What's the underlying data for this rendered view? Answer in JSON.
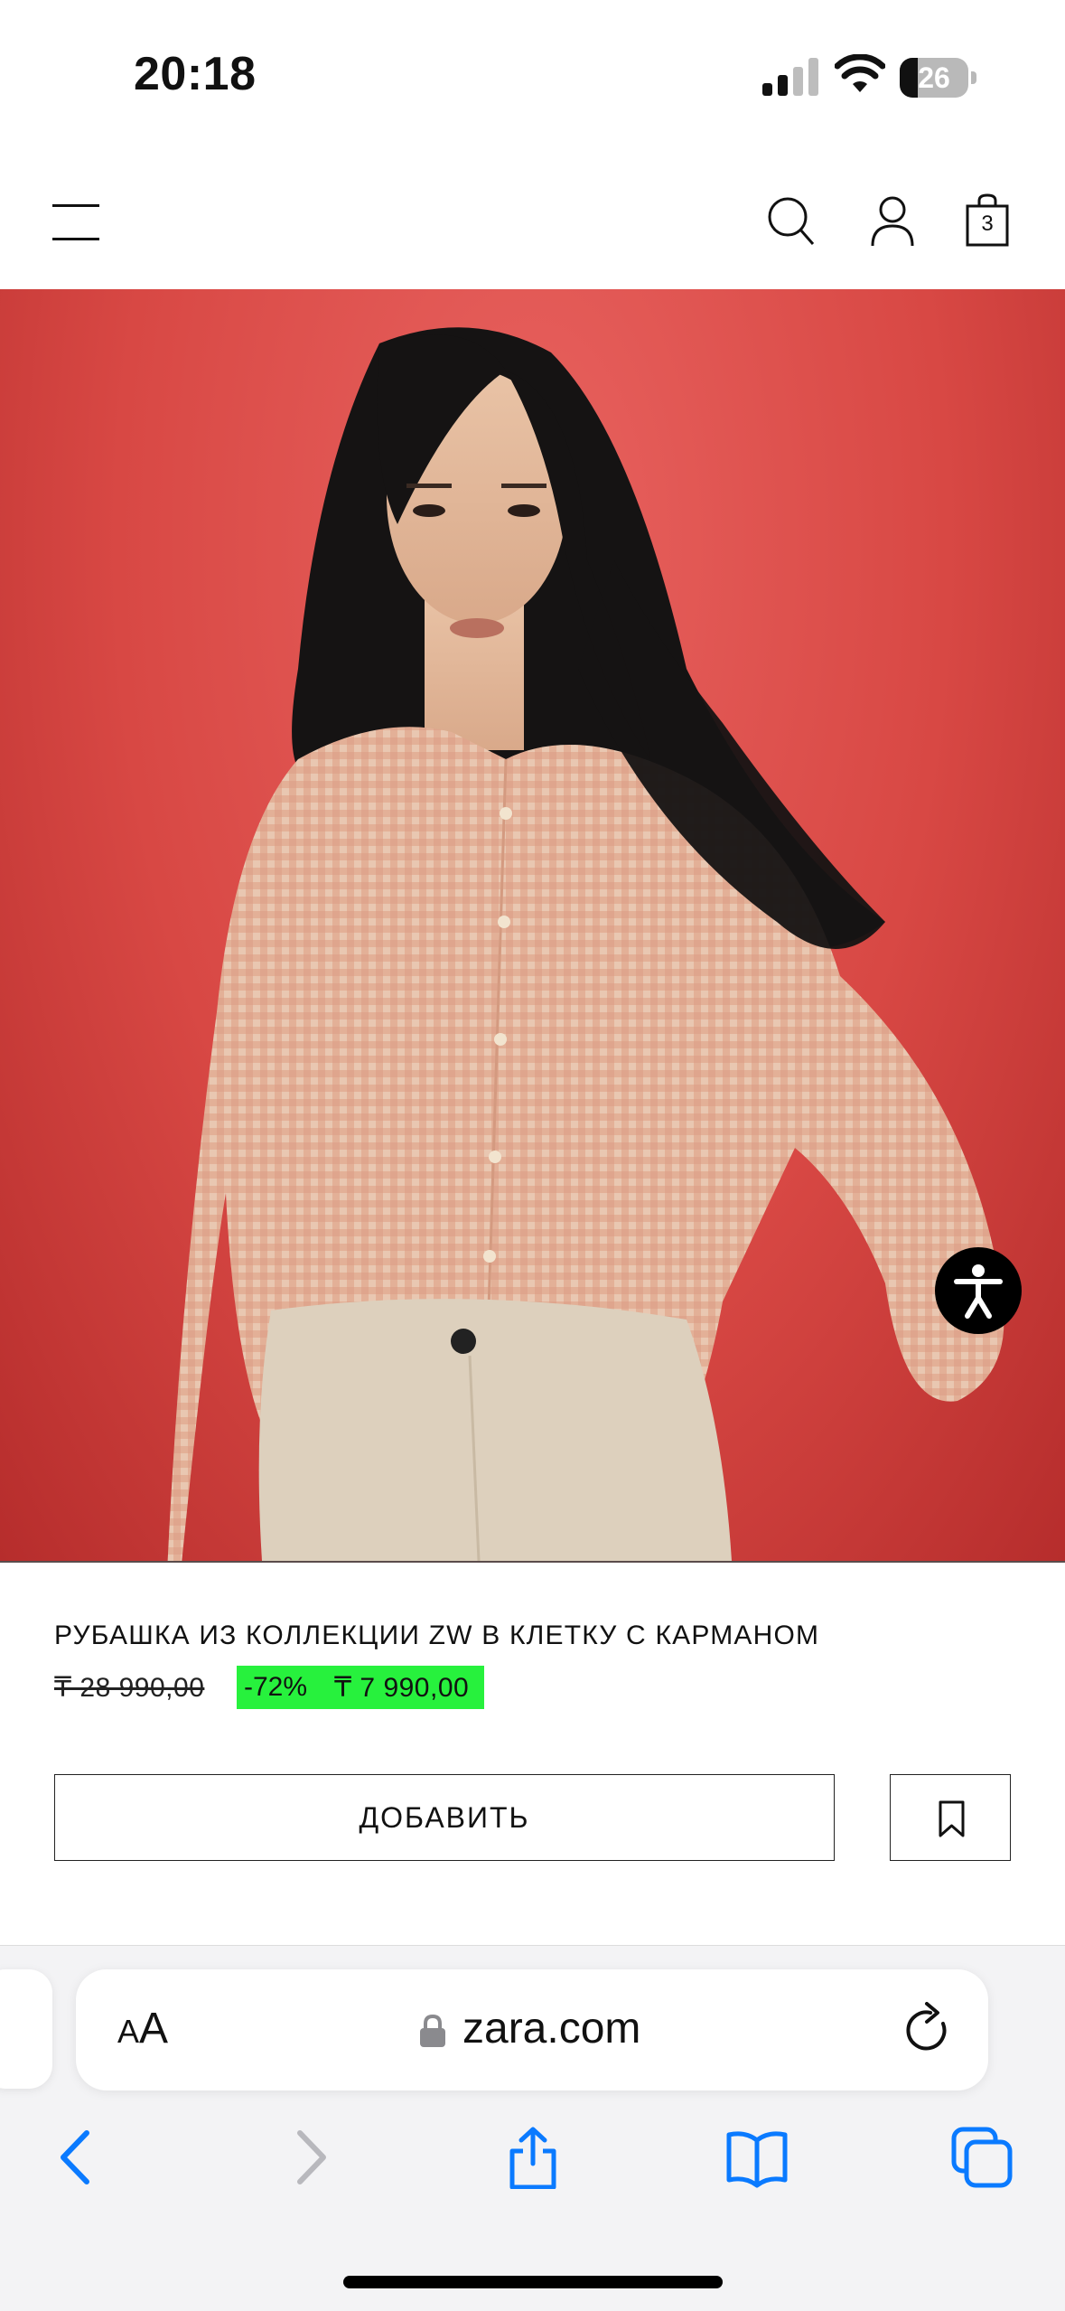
{
  "status_bar": {
    "time": "20:18",
    "battery": "26",
    "battery_level": 0.26
  },
  "header": {
    "menu_icon": "hamburger-menu-icon",
    "search_icon": "search-icon",
    "account_icon": "user-icon",
    "cart_icon": "shopping-bag-icon",
    "cart_count": "3"
  },
  "product": {
    "image": "model-in-checked-shirt",
    "title": "РУБАШКА ИЗ КОЛЛЕКЦИИ ZW В КЛЕТКУ С КАРМАНОМ",
    "old_price": "₸ 28 990,00",
    "discount": "-72%",
    "new_price": "₸ 7 990,00",
    "sale_color": "#27f13d",
    "add_label": "ДОБАВИТЬ",
    "bookmark_icon": "bookmark-icon",
    "accessibility_icon": "accessibility-icon"
  },
  "browser": {
    "text_size_big": "A",
    "text_size_small": "A",
    "lock_icon": "lock-icon",
    "url": "zara.com",
    "reload_icon": "reload-icon",
    "toolbar": [
      "back-icon",
      "forward-icon",
      "share-icon",
      "bookmarks-icon",
      "tabs-icon"
    ],
    "accent_color": "#0a7aff"
  }
}
